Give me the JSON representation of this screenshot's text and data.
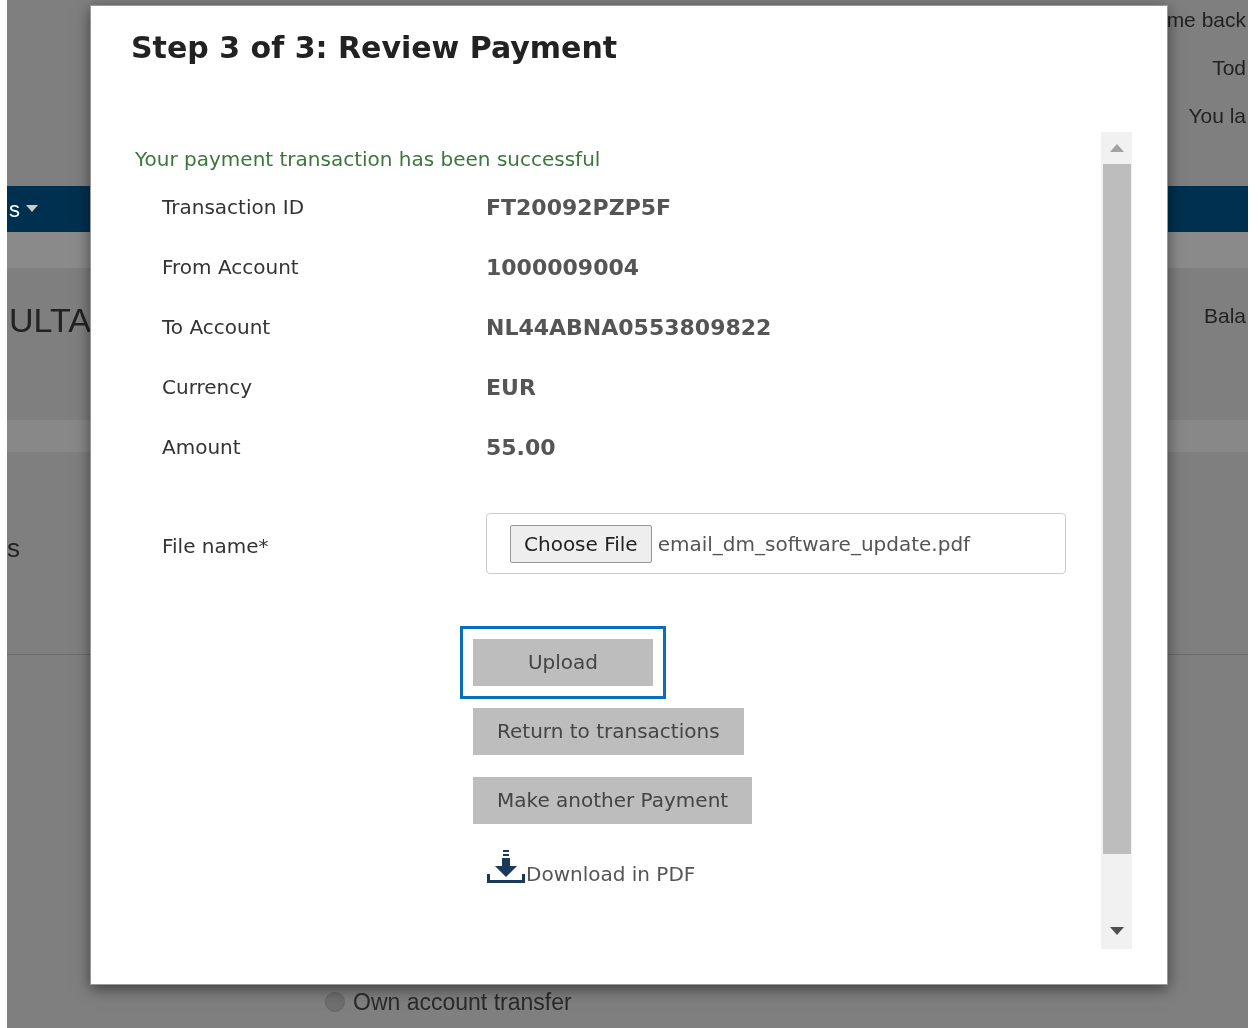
{
  "background": {
    "header_texts": [
      "me back",
      "Tod",
      "You la"
    ],
    "nav_item": "s",
    "heading": "ULTA",
    "balance_label": "Bala",
    "section_label": "s",
    "radio": {
      "label": "Own account transfer",
      "selected": false
    }
  },
  "modal": {
    "title": "Step 3 of 3: Review Payment",
    "message": "Your payment transaction has been successful",
    "details": [
      {
        "label": "Transaction ID",
        "value": "FT20092PZP5F"
      },
      {
        "label": "From Account",
        "value": "1000009004"
      },
      {
        "label": "To Account",
        "value": "NL44ABNA0553809822"
      },
      {
        "label": "Currency",
        "value": "EUR"
      },
      {
        "label": "Amount",
        "value": "55.00"
      }
    ],
    "file": {
      "label": "File name*",
      "button": "Choose File",
      "value": "email_dm_software_update.pdf"
    },
    "buttons": [
      {
        "label": "Upload",
        "focused": true
      },
      {
        "label": "Return to transactions",
        "focused": false
      },
      {
        "label": "Make another Payment",
        "focused": false
      }
    ],
    "download": "Download in PDF"
  }
}
